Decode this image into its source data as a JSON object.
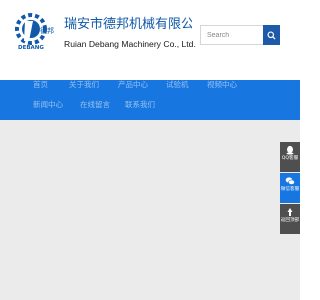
{
  "header": {
    "logo_badge": "德邦",
    "logo_brand": "DEBANG",
    "company_name_zh": "瑞安市德邦机械有限公司",
    "company_name_en": "Ruian Debang Machinery Co., Ltd."
  },
  "search": {
    "placeholder": "Search",
    "button_icon": "search-icon"
  },
  "nav": {
    "items": [
      {
        "label": "首页"
      },
      {
        "label": "关于我们"
      },
      {
        "label": "产品中心"
      },
      {
        "label": "试验机"
      },
      {
        "label": "视频中心"
      },
      {
        "label": "新闻中心"
      },
      {
        "label": "在线留言"
      },
      {
        "label": "联系我们"
      }
    ]
  },
  "float_bar": {
    "items": [
      {
        "label": "QQ客服",
        "icon": "qq-icon"
      },
      {
        "label": "微信客服",
        "icon": "wechat-icon"
      },
      {
        "label": "返回顶部",
        "icon": "back-to-top-icon"
      }
    ]
  },
  "colors": {
    "brand_blue": "#1259a9",
    "nav_blue": "#1776e0",
    "float_gray": "#4f4f4f",
    "main_bg": "#ebebeb"
  }
}
